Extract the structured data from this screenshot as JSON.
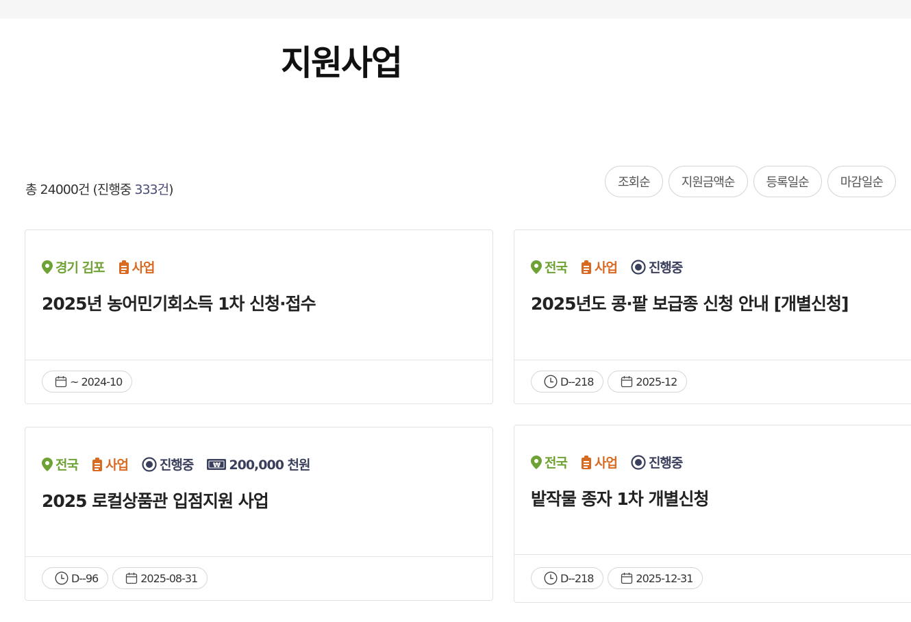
{
  "header": {
    "title": "지원사업"
  },
  "summary": {
    "prefix": "총 24000건 (진행중 ",
    "highlight": "333건",
    "suffix": ")"
  },
  "sort_options": [
    "조회순",
    "지원금액순",
    "등록일순",
    "마감일순"
  ],
  "cards": [
    {
      "region": "경기 김포",
      "kind": "사업",
      "title": "2025년 농어민기회소득 1차 신청·접수",
      "period": "~ 2024-10"
    },
    {
      "region": "전국",
      "kind": "사업",
      "status": "진행중",
      "title": "2025년도 콩·팥 보급종 신청 안내 [개별신청]",
      "dday": "D--218",
      "deadline": "2025-12"
    },
    {
      "region": "전국",
      "kind": "사업",
      "status": "진행중",
      "amount": "200,000 천원",
      "title": "2025 로컬상품관 입점지원 사업",
      "dday": "D--96",
      "deadline": "2025-08-31"
    },
    {
      "region": "전국",
      "kind": "사업",
      "status": "진행중",
      "title": "밭작물 종자 1차 개별신청",
      "dday": "D--218",
      "deadline": "2025-12-31"
    }
  ],
  "icons": {
    "region": "location-pin-icon",
    "kind": "clipboard-icon",
    "status": "radio-dot-icon",
    "amount": "won-banknote-icon",
    "dday": "clock-icon",
    "deadline": "calendar-icon"
  },
  "colors": {
    "region": "#6fa234",
    "kind": "#d96a22",
    "status": "#3a3f5c",
    "highlight": "#4a4a7a"
  }
}
